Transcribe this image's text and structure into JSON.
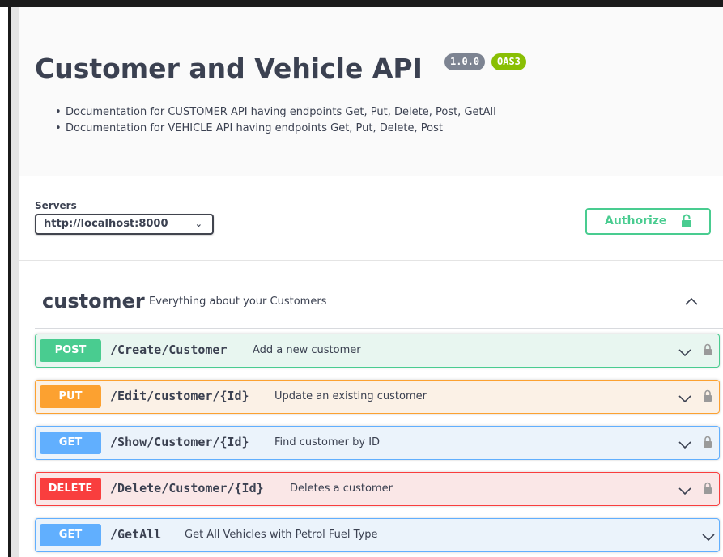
{
  "info": {
    "title": "Customer and Vehicle API",
    "version": "1.0.0",
    "oas_badge": "OAS3",
    "description": [
      "Documentation for CUSTOMER API having endpoints Get, Put, Delete, Post, GetAll",
      "Documentation for VEHICLE API having endpoints Get, Put, Delete, Post"
    ]
  },
  "servers": {
    "label": "Servers",
    "selected": "http://localhost:8000"
  },
  "authorize": {
    "label": "Authorize",
    "icon": "lock-icon",
    "color": "#49cc90"
  },
  "tag": {
    "name": "customer",
    "description": "Everything about your Customers"
  },
  "operations": [
    {
      "method": "POST",
      "path": "/Create/Customer",
      "summary": "Add a new customer",
      "color": "#49cc90",
      "locked": true
    },
    {
      "method": "PUT",
      "path": "/Edit/customer/{Id}",
      "summary": "Update an existing customer",
      "color": "#fca130",
      "locked": true
    },
    {
      "method": "GET",
      "path": "/Show/Customer/{Id}",
      "summary": "Find customer by ID",
      "color": "#61affe",
      "locked": true
    },
    {
      "method": "DELETE",
      "path": "/Delete/Customer/{Id}",
      "summary": "Deletes a customer",
      "color": "#f93e3e",
      "locked": true
    },
    {
      "method": "GET",
      "path": "/GetAll",
      "summary": "Get All Vehicles with Petrol Fuel Type",
      "color": "#61affe",
      "locked": false
    }
  ]
}
